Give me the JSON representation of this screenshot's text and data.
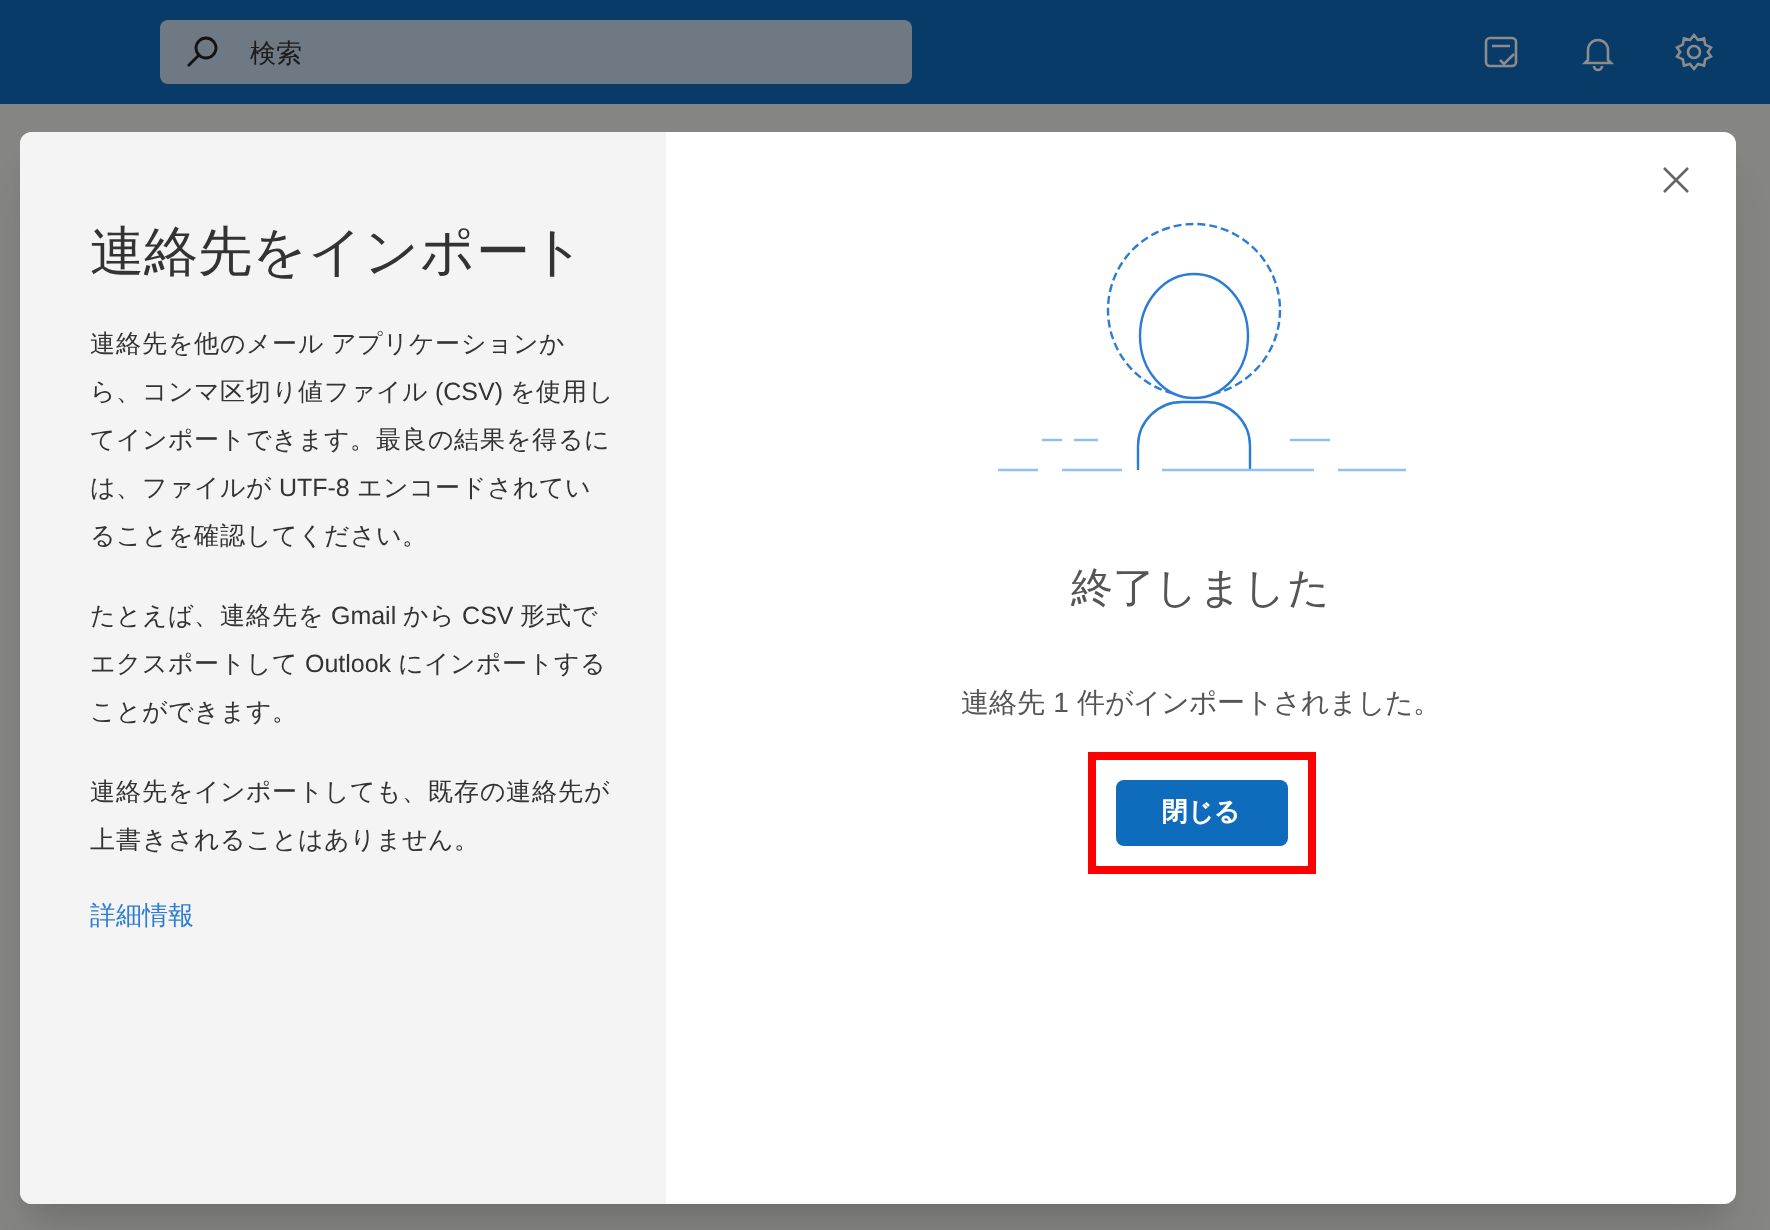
{
  "top_bar": {
    "search": {
      "placeholder": "検索"
    }
  },
  "dialog": {
    "title": "連絡先をインポート",
    "paragraphs": [
      "連絡先を他のメール アプリケーションから、コンマ区切り値ファイル (CSV) を使用してインポートできます。最良の結果を得るには、ファイルが UTF-8 エンコードされていることを確認してください。",
      "たとえば、連絡先を Gmail から CSV 形式でエクスポートして Outlook にインポートすることができます。",
      "連絡先をインポートしても、既存の連絡先が上書きされることはありません。"
    ],
    "link": "詳細情報",
    "status_title": "終了しました",
    "status_message": "連絡先 1 件がインポートされました。",
    "close_button": {
      "label": "閉じる",
      "highlighted": true
    }
  }
}
